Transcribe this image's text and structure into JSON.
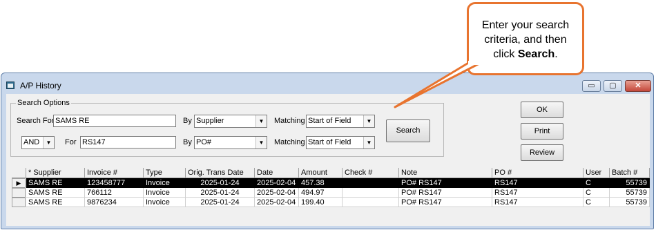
{
  "callout": {
    "line1": "Enter your search",
    "line2": "criteria, and then",
    "line3_pre": "click ",
    "line3_bold": "Search",
    "line3_post": "."
  },
  "window": {
    "title": "A/P History",
    "min_glyph": "▭",
    "max_glyph": "▢",
    "close_glyph": "✕"
  },
  "search_options": {
    "legend": "Search Options",
    "search_for_label": "Search For",
    "search_for_value": "SAMS RE",
    "by_label": "By",
    "by1_value": "Supplier",
    "matching_label": "Matching",
    "matching1_value": "Start of Field",
    "conjunction_value": "AND",
    "for_label": "For",
    "for_value": "RS147",
    "by2_value": "PO#",
    "matching2_value": "Start of Field",
    "search_button": "Search"
  },
  "buttons": {
    "ok": "OK",
    "print": "Print",
    "review": "Review"
  },
  "grid": {
    "columns": [
      "* Supplier",
      "Invoice #",
      "Type",
      "Orig. Trans Date",
      "Date",
      "Amount",
      "Check #",
      "Note",
      "PO #",
      "User",
      "Batch #"
    ],
    "rows": [
      [
        "SAMS RE",
        "123458777",
        "Invoice",
        "2025-01-24",
        "2025-02-04",
        "457.38",
        "",
        "PO# RS147",
        "RS147",
        "C",
        "55739"
      ],
      [
        "SAMS RE",
        "766112",
        "Invoice",
        "2025-01-24",
        "2025-02-04",
        "494.97",
        "",
        "PO# RS147",
        "RS147",
        "C",
        "55739"
      ],
      [
        "SAMS RE",
        "9876234",
        "Invoice",
        "2025-01-24",
        "2025-02-04",
        "199.40",
        "",
        "PO# RS147",
        "RS147",
        "C",
        "55739"
      ]
    ],
    "selected_row_marker": "▶"
  },
  "colors": {
    "callout_border": "#e8742f",
    "window_frame": "#c9d8ec",
    "selected_row": "#000000"
  }
}
